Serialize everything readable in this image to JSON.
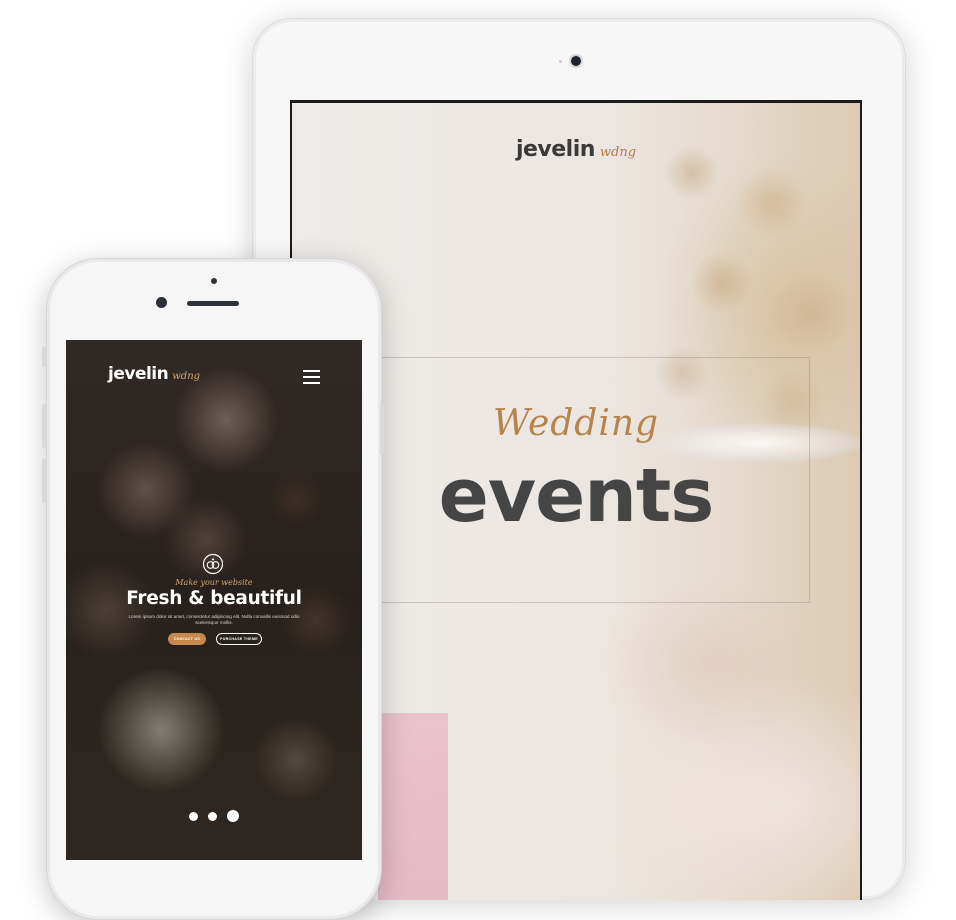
{
  "tablet": {
    "logo_word": "jevelin",
    "logo_tag": "wdng",
    "hero_script": "Wedding",
    "hero_heading": "events"
  },
  "phone": {
    "logo_word": "jevelin",
    "logo_tag": "wdng",
    "menu_icon": "hamburger-menu-icon",
    "emblem_icon": "rings-emblem-icon",
    "kicker": "Make your website",
    "title": "Fresh & beautiful",
    "body": "Lorem ipsum dolor sit amet, consectetur adipiscing elit. Nulla convallis euismod odio scelerisque mollis.",
    "primary_button": "CONTACT US",
    "secondary_button": "PURCHASE THEME",
    "slider": {
      "count": 3,
      "active_index": 2
    }
  },
  "colors": {
    "accent": "#c8894b",
    "tablet_heading": "#454545",
    "script": "#b8844d"
  }
}
